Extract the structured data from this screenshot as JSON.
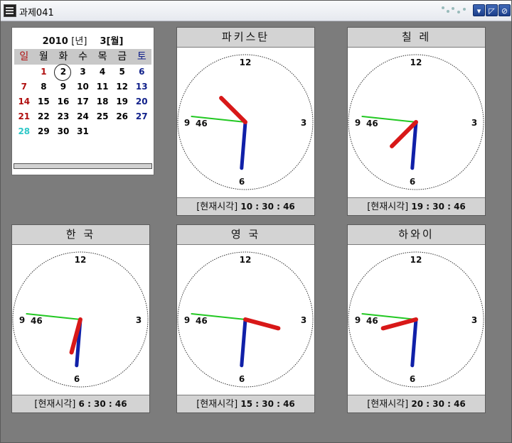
{
  "window": {
    "title": "과제041"
  },
  "calendar": {
    "year": "2010",
    "year_suffix": "[년]",
    "month": "3[월]",
    "weekdays": [
      "일",
      "월",
      "화",
      "수",
      "목",
      "금",
      "토"
    ],
    "weeks": [
      [
        "",
        "1",
        "2",
        "3",
        "4",
        "5",
        "6"
      ],
      [
        "7",
        "8",
        "9",
        "10",
        "11",
        "12",
        "13"
      ],
      [
        "14",
        "15",
        "16",
        "17",
        "18",
        "19",
        "20"
      ],
      [
        "21",
        "22",
        "23",
        "24",
        "25",
        "26",
        "27"
      ],
      [
        "28",
        "29",
        "30",
        "31",
        "",
        "",
        ""
      ]
    ],
    "today": "2"
  },
  "clocks": [
    {
      "name": "파키스탄",
      "time_label": "[현재시각]",
      "time": "10 : 30 : 46",
      "hour": 10,
      "minute": 30,
      "second": 46
    },
    {
      "name": "칠  레",
      "time_label": "[현재시각]",
      "time": "19 : 30 : 46",
      "hour": 19,
      "minute": 30,
      "second": 46
    },
    {
      "name": "한  국",
      "time_label": "[현재시각]",
      "time": "6 : 30 : 46",
      "hour": 6,
      "minute": 30,
      "second": 46
    },
    {
      "name": "영  국",
      "time_label": "[현재시각]",
      "time": "15 : 30 : 46",
      "hour": 15,
      "minute": 30,
      "second": 46
    },
    {
      "name": "하와이",
      "time_label": "[현재시각]",
      "time": "20 : 30 : 46",
      "hour": 20,
      "minute": 30,
      "second": 46
    }
  ],
  "dial": {
    "n12": "12",
    "n3": "3",
    "n6": "6",
    "n9": "9",
    "second_readout": "46"
  },
  "colors": {
    "hour_hand": "#d81818",
    "minute_hand": "#1020a8",
    "second_hand": "#22c822"
  }
}
